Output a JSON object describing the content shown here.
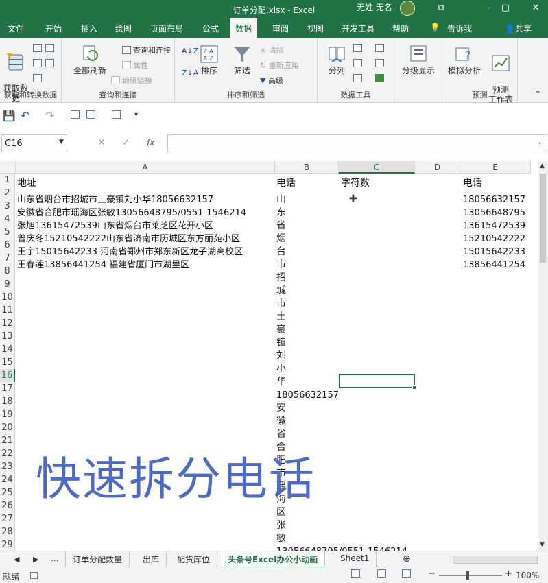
{
  "window": {
    "title": "订单分配.xlsx - Excel",
    "user": "无姓 无名",
    "min": "—",
    "restore": "▢",
    "close": "✕",
    "ribbon_opts": "⧉"
  },
  "tabs": [
    "文件",
    "开始",
    "插入",
    "绘图",
    "页面布局",
    "公式",
    "数据",
    "审阅",
    "视图",
    "开发工具",
    "帮助"
  ],
  "active_tab": "数据",
  "tell_me": "告诉我",
  "share": "共享",
  "ribbon": {
    "get_data": "获取数\n据",
    "group1": "获取和转换数据",
    "refresh_all": "全部刷新",
    "query_conn": "查询和连接",
    "properties": "属性",
    "edit_links": "编辑链接",
    "group2": "查询和连接",
    "sort": "排序",
    "filter": "筛选",
    "clear": "清除",
    "reapply": "重新应用",
    "advanced": "高级",
    "group3": "排序和筛选",
    "split": "分列",
    "group4": "数据工具",
    "outline": "分级显示",
    "what_if": "模拟分析",
    "forecast_sheet": "预测\n工作表",
    "group5": "预测"
  },
  "formula_bar": {
    "name_box": "C16",
    "cancel": "✕",
    "enter": "✓",
    "fx": "fx",
    "value": ""
  },
  "columns": [
    "A",
    "B",
    "C",
    "D",
    "E"
  ],
  "rows": [
    "1",
    "2",
    "3",
    "4",
    "5",
    "6",
    "7",
    "8",
    "9",
    "10",
    "11",
    "12",
    "13",
    "14",
    "15",
    "16",
    "17",
    "18",
    "19",
    "20",
    "21",
    "22",
    "23",
    "24",
    "25",
    "26",
    "27",
    "28",
    "29"
  ],
  "cells": {
    "A1": "地址",
    "B1": "电话",
    "C1": "字符数",
    "E1": "电话",
    "A2": "山东省烟台市招城市土豪镇刘小华18056632157",
    "A3": "安徽省合肥市瑶海区张敏13056648795/0551-1546214",
    "A4": "张旭13615472539山东省烟台市莱芝区花开小区",
    "A5": "曾庆冬15210542222山东省济南市历城区东方丽苑小区",
    "A6": "王宇15015642233 河南省郑州市郑东新区龙子湖高校区",
    "A7": "王春莲13856441254 福建省厦门市湖里区",
    "E2": "18056632157",
    "E3": "13056648795",
    "E4": "13615472539",
    "E5": "15210542222",
    "E6": "15015642233",
    "E7": "13856441254",
    "B17": "18056632157",
    "B29": "13056648795/0551-1546214"
  },
  "b_column_chars": [
    "山",
    "东",
    "省",
    "烟",
    "台",
    "市",
    "招",
    "城",
    "市",
    "土",
    "豪",
    "镇",
    "刘",
    "小",
    "华"
  ],
  "b_column_chars2": [
    "安",
    "徽",
    "省",
    "合",
    "肥",
    "市",
    "瑶",
    "海",
    "区",
    "张",
    "敏"
  ],
  "overlay_text": "快速拆分电话",
  "sheet_tabs": [
    "...",
    "订单分配数量",
    "出库",
    "配货库位",
    "头条号Excel办公小动画",
    "Sheet1"
  ],
  "active_sheet": "头条号Excel办公小动画",
  "status": {
    "ready": "就绪",
    "zoom": "100%"
  }
}
